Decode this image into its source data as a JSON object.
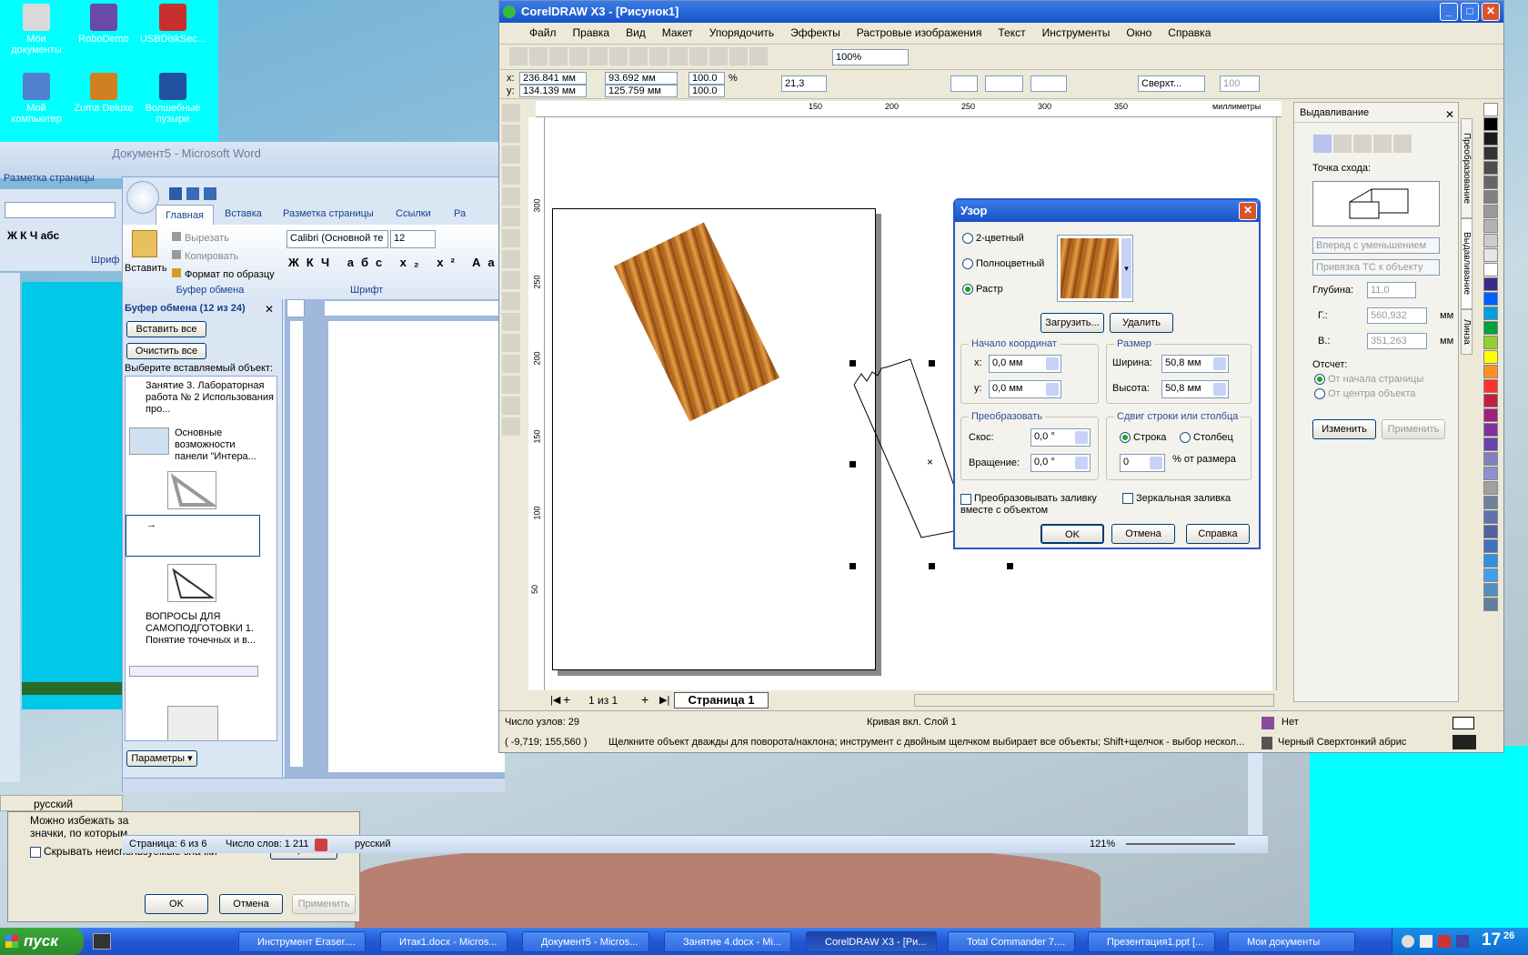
{
  "desktop": {
    "icons": [
      {
        "label": "Мои документы",
        "color": "#d9d9d9"
      },
      {
        "label": "RoboDemo",
        "color": "#6a4aa8"
      },
      {
        "label": "USBDiskSec...",
        "color": "#c83030"
      },
      {
        "label": "Мой компьютер",
        "color": "#5080d0"
      },
      {
        "label": "Zuma Deluxe",
        "color": "#d08020"
      },
      {
        "label": "Волшебные пузыри",
        "color": "#2050a0"
      }
    ]
  },
  "word": {
    "back_title": "Документ5 - Microsoft Word",
    "back_ribbon": "Разметка страницы",
    "tabs": [
      "Главная",
      "Вставка",
      "Разметка страницы",
      "Ссылки",
      "Ра"
    ],
    "clipboard_group": "Буфер обмена",
    "paste": "Вставить",
    "cut": "Вырезать",
    "copy": "Копировать",
    "format_painter": "Формат по образцу",
    "font_group": "Шрифт",
    "font_name": "Calibri (Основной те",
    "font_size": "12",
    "side_font_group": "Шриф",
    "pane_title": "Буфер обмена (12 из 24)",
    "paste_all": "Вставить все",
    "clear_all": "Очистить все",
    "select_label": "Выберите вставляемый объект:",
    "items": [
      {
        "text": "Занятие 3. Лабораторная работа № 2 Использования про..."
      },
      {
        "text": "Основные возможности панели \"Интера..."
      },
      {
        "text": ""
      },
      {
        "text": "→"
      },
      {
        "text": ""
      },
      {
        "text": "ВОПРОСЫ ДЛЯ САМОПОДГОТОВКИ 1. Понятие точечных и в..."
      },
      {
        "text": ""
      },
      {
        "text": ""
      }
    ],
    "params": "Параметры",
    "status_page": "Страница: 6 из 6",
    "status_words": "Число слов: 1 211",
    "status_lang": "русский",
    "zoom": "121%",
    "lang_bar": "русский"
  },
  "dialog_back": {
    "text1": "Можно избежать за",
    "text2": "значки, по которым",
    "hide_check": "Скрывать неиспользуемые значки",
    "setup": "Настроить...",
    "ok": "OK",
    "cancel": "Отмена",
    "apply": "Применить"
  },
  "corel": {
    "title": "CorelDRAW X3 - [Рисунок1]",
    "menu": [
      "Файл",
      "Правка",
      "Вид",
      "Макет",
      "Упорядочить",
      "Эффекты",
      "Растровые изображения",
      "Текст",
      "Инструменты",
      "Окно",
      "Справка"
    ],
    "zoom": "100%",
    "x": "236.841 мм",
    "y": "134.139 мм",
    "w": "93.692 мм",
    "h": "125.759 мм",
    "sx": "100.0",
    "sy": "100.0",
    "percent": "%",
    "angle": "21,3",
    "outline": "Сверхт...",
    "outline_num": "100",
    "ruler_h": [
      "150",
      "200",
      "250",
      "300",
      "350"
    ],
    "ruler_units": "миллиметры",
    "ruler_v": [
      "300",
      "250",
      "200",
      "150",
      "100",
      "50"
    ],
    "page_of": "1 из 1",
    "page_tab": "Страница 1",
    "status_nodes": "Число узлов: 29",
    "status_layer": "Кривая вкл. Слой 1",
    "status_coords": "( -9,719; 155,560 )",
    "status_hint": "Щелкните объект дважды для поворота/наклона; инструмент с двойным щелчком выбирает все объекты; Shift+щелчок - выбор нескол...",
    "fill_none": "Нет",
    "outline_desc": "Черный  Сверхтонкий абрис",
    "palette": [
      "#000000",
      "#1a1a1a",
      "#333333",
      "#4d4d4d",
      "#666666",
      "#808080",
      "#999999",
      "#b3b3b3",
      "#cccccc",
      "#e6e6e6",
      "#ffffff",
      "#3a2a8a",
      "#0060ff",
      "#00a0e0",
      "#00a040",
      "#90d030",
      "#ffff00",
      "#ff9020",
      "#ff3030",
      "#c02040",
      "#a02080",
      "#8030a0",
      "#6a40b0",
      "#8080c0",
      "#9090d0",
      "#a0a0a0",
      "#7080a0",
      "#6070b0",
      "#5060a0",
      "#4070c0",
      "#3090e0",
      "#40a0f0",
      "#5090c0",
      "#6080a0"
    ]
  },
  "docker": {
    "title": "Выдавливание",
    "vanish_label": "Точка схода:",
    "combo1": "Вперед с уменьшением",
    "combo2": "Привязка ТС к объекту",
    "depth_label": "Глубина:",
    "depth": "11,0",
    "g_label": "Г.:",
    "g_val": "560,932",
    "v_label": "В.:",
    "v_val": "351,263",
    "unit": "мм",
    "ref_label": "Отсчет:",
    "ref1": "От начала страницы",
    "ref2": "От центра объекта",
    "change": "Изменить",
    "apply": "Применить",
    "tabs": [
      "Преобразование",
      "Выдавливание",
      "Линза"
    ]
  },
  "uzor": {
    "title": "Узор",
    "opt1": "2-цветный",
    "opt2": "Полноцветный",
    "opt3": "Растр",
    "load": "Загрузить...",
    "delete": "Удалить",
    "origin": "Начало координат",
    "x_label": "x:",
    "x_val": "0,0 мм",
    "y_label": "y:",
    "y_val": "0,0 мм",
    "size": "Размер",
    "w_label": "Ширина:",
    "w_val": "50,8 мм",
    "h_label": "Высота:",
    "h_val": "50,8 мм",
    "transform": "Преобразовать",
    "skew_label": "Скос:",
    "skew_val": "0,0 °",
    "rot_label": "Вращение:",
    "rot_val": "0,0 °",
    "shift": "Сдвиг строки или столбца",
    "row": "Строка",
    "col": "Столбец",
    "shift_val": "0",
    "shift_unit": "% от размера",
    "transform_fill": "Преобразовывать заливку вместе с объектом",
    "mirror": "Зеркальная заливка",
    "ok": "OK",
    "cancel": "Отмена",
    "help": "Справка"
  },
  "taskbar": {
    "start": "пуск",
    "items": [
      "Инструмент Eraser....",
      "Итак1.docx - Micros...",
      "Документ5 - Micros...",
      "Занятие 4.docx - Mi...",
      "CorelDRAW X3 - [Ри...",
      "Total Commander 7....",
      "Презентация1.ppt [...",
      "Мои документы"
    ],
    "clock_h": "17",
    "clock_m": "26"
  }
}
